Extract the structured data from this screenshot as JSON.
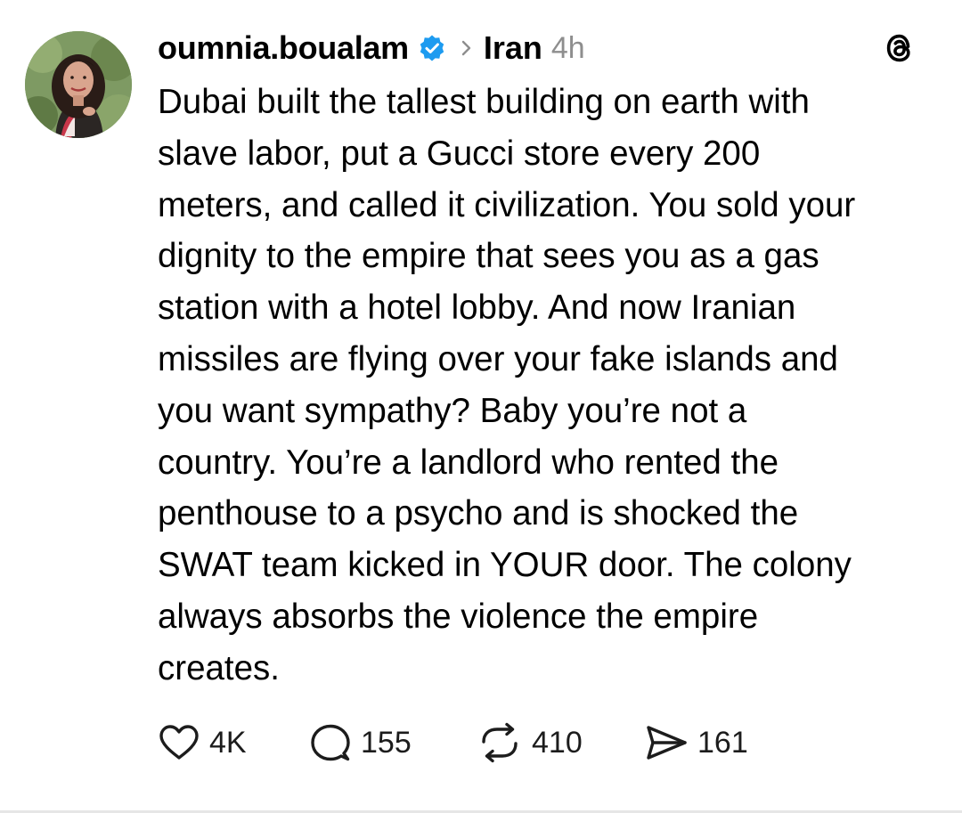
{
  "post": {
    "author": {
      "username": "oumnia.boualam",
      "verified": true,
      "avatar_icon": "profile-photo"
    },
    "topic": "Iran",
    "time_ago": "4h",
    "app_icon": "threads-logo-icon",
    "text": "Dubai built the tallest building on earth with slave labor, put a Gucci store every 200 meters, and called it civilization. You sold your dignity to the empire that sees you as a gas station with a hotel lobby. And now Iranian missiles are flying over your fake islands and you want sympathy? Baby you’re not a country. You’re a landlord who rented the penthouse to a psycho and is shocked the SWAT team kicked in YOUR door. The colony always absorbs the violence the empire creates.",
    "lines": [
      "Dubai built the tallest building on earth with",
      "slave labor, put a Gucci store every 200",
      "meters, and called it civilization. You sold your",
      "dignity to the empire that sees you as a gas",
      "station with a hotel lobby. And now Iranian",
      "missiles are flying over your fake islands and",
      "you want sympathy? Baby you’re not a",
      "country. You’re a landlord who rented the",
      "penthouse to a psycho and is shocked the",
      "SWAT team kicked in YOUR door. The colony",
      "always absorbs the violence the empire",
      "creates."
    ],
    "actions": {
      "likes": "4K",
      "replies": "155",
      "reposts": "410",
      "shares": "161"
    }
  },
  "colors": {
    "verified_badge": "#1d9bf0",
    "secondary_text": "#8e8e8e",
    "primary_text": "#000000"
  }
}
